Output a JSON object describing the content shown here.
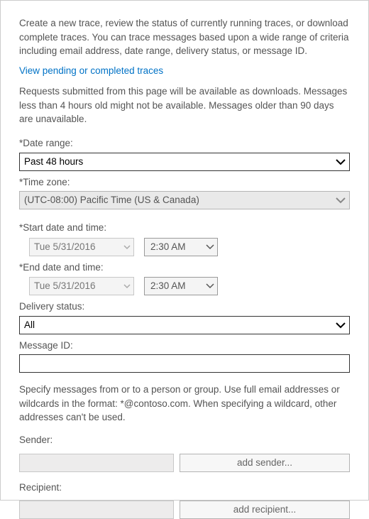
{
  "intro": "Create a new trace, review the status of currently running traces, or download complete traces. You can trace messages based upon a wide range of criteria including email address, date range, delivery status, or message ID.",
  "pending_link": "View pending or completed traces",
  "requests_note": "Requests submitted from this page will be available as downloads. Messages less than 4 hours old might not be available. Messages older than 90 days are unavailable.",
  "date_range": {
    "label": "*Date range:",
    "value": "Past 48 hours"
  },
  "time_zone": {
    "label": "*Time zone:",
    "value": "(UTC-08:00) Pacific Time (US & Canada)"
  },
  "start_dt": {
    "label": "*Start date and time:",
    "date": "Tue 5/31/2016",
    "time": "2:30 AM"
  },
  "end_dt": {
    "label": "*End date and time:",
    "date": "Tue 5/31/2016",
    "time": "2:30 AM"
  },
  "delivery_status": {
    "label": "Delivery status:",
    "value": "All"
  },
  "message_id": {
    "label": "Message ID:",
    "value": ""
  },
  "specify_note": "Specify messages from or to a person or group. Use full email addresses or wildcards in the format: *@contoso.com. When specifying a wildcard, other addresses can't be used.",
  "sender": {
    "label": "Sender:",
    "btn": "add sender..."
  },
  "recipient": {
    "label": "Recipient:",
    "btn": "add recipient..."
  }
}
